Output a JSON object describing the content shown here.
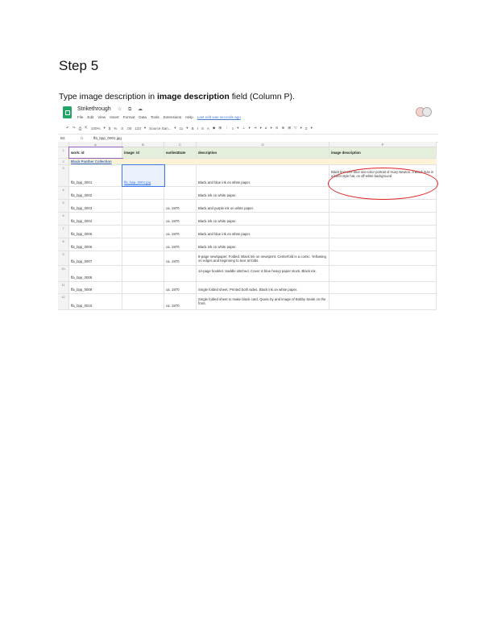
{
  "heading": "Step 5",
  "instruction": {
    "pre": "Type image description in ",
    "bold": "image description",
    "post": " field (Column P)."
  },
  "app": {
    "title": "Strikethrough",
    "title_icons": "☆ ⧉ ☁",
    "menu": [
      "File",
      "Edit",
      "View",
      "Insert",
      "Format",
      "Data",
      "Tools",
      "Extensions",
      "Help"
    ],
    "last_edit": "Last edit was seconds ago",
    "toolbar": [
      "↶",
      "↷",
      "⎙",
      "⇱",
      "100%",
      "▾",
      "$",
      "%",
      ".0",
      ".00",
      "123",
      "▾",
      "Source San...",
      "▾",
      "11",
      "▾",
      "B",
      "I",
      "S",
      "A",
      "◆",
      "⊞",
      "⋮",
      "≡",
      "▾",
      "⊥",
      "▾",
      "⇥",
      "▾",
      "⌀",
      "▾",
      "⊝",
      "⊕",
      "⊞",
      "▽",
      "▾",
      "Σ",
      "▾"
    ]
  },
  "formula": {
    "cell_ref": "B3",
    "fx": "fx",
    "value": "ffa_bpp_0001.jpg"
  },
  "grid": {
    "col_letters": [
      "A",
      "B",
      "C",
      "O",
      "P"
    ],
    "headers": [
      "work: id",
      "image: id",
      "earliestDate",
      "description",
      "image description"
    ],
    "collection": "Black Panther Collection",
    "rows": [
      {
        "num": "3",
        "id": "ffa_bpp_0001",
        "image": "ffa_bpp_0001.jpg",
        "date": "",
        "desc": "Black and blue ink on white paper.",
        "imgdesc": "Black text over blue one-color portrait of Huey Newton, a Black man in a beret style hat, on off-white background"
      },
      {
        "num": "4",
        "id": "ffa_bpp_0002",
        "image": "",
        "date": "",
        "desc": "Black ink on white paper.",
        "imgdesc": ""
      },
      {
        "num": "5",
        "id": "ffa_bpp_0003",
        "image": "",
        "date": "ca. 1970",
        "desc": "Black and purple ink on white paper.",
        "imgdesc": ""
      },
      {
        "num": "6",
        "id": "ffa_bpp_0004",
        "image": "",
        "date": "ca. 1970",
        "desc": "Black ink on white paper.",
        "imgdesc": ""
      },
      {
        "num": "7",
        "id": "ffa_bpp_0005",
        "image": "",
        "date": "ca. 1970",
        "desc": "Black and blue ink on white paper.",
        "imgdesc": ""
      },
      {
        "num": "8",
        "id": "ffa_bpp_0006",
        "image": "",
        "date": "ca. 1970",
        "desc": "Black ink on white paper.",
        "imgdesc": ""
      },
      {
        "num": "9",
        "id": "ffa_bpp_0007",
        "image": "",
        "date": "ca. 1970",
        "desc": "8-page newspaper. Folded. Black ink on newsprint. Centerfold is a comic. Yellowing on edges and beginning to tear at folds.",
        "imgdesc": ""
      },
      {
        "num": "10",
        "id": "ffa_bpp_0008",
        "image": "",
        "date": "",
        "desc": "14-page booklet. Saddle stitched. Cover is blue heavy paper stock. Black ink.",
        "imgdesc": ""
      },
      {
        "num": "11",
        "id": "ffa_bpp_0009",
        "image": "",
        "date": "ca. 1970",
        "desc": "Single folded sheet. Printed both sides. Black ink on white paper.",
        "imgdesc": ""
      },
      {
        "num": "12",
        "id": "ffa_bpp_0010",
        "image": "",
        "date": "ca. 1970",
        "desc": "Single folded sheet to make black card. Quote by and image of Bobby Seale on the front.",
        "imgdesc": ""
      }
    ]
  }
}
